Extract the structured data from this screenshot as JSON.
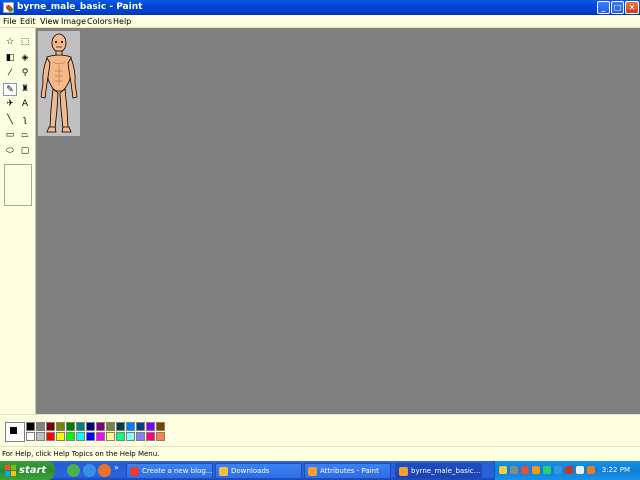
{
  "window": {
    "title": "byrne_male_basic - Paint",
    "buttons": {
      "minimize": "_",
      "maximize": "□",
      "close": "✕"
    }
  },
  "menubar": {
    "items": [
      {
        "label": "File"
      },
      {
        "label": "Edit"
      },
      {
        "label": "View"
      },
      {
        "label": "Image"
      },
      {
        "label": "Colors"
      },
      {
        "label": "Help"
      }
    ]
  },
  "toolbox": {
    "tools": [
      {
        "name": "free-form-select-icon",
        "glyph": "☆"
      },
      {
        "name": "rect-select-icon",
        "glyph": "⬚"
      },
      {
        "name": "eraser-icon",
        "glyph": "◧"
      },
      {
        "name": "fill-bucket-icon",
        "glyph": "◈"
      },
      {
        "name": "pick-color-icon",
        "glyph": "⁄"
      },
      {
        "name": "magnifier-icon",
        "glyph": "⚲"
      },
      {
        "name": "pencil-icon",
        "glyph": "✎",
        "selected": true
      },
      {
        "name": "brush-icon",
        "glyph": "♜"
      },
      {
        "name": "airbrush-icon",
        "glyph": "✈"
      },
      {
        "name": "text-icon",
        "glyph": "A"
      },
      {
        "name": "line-icon",
        "glyph": "╲"
      },
      {
        "name": "curve-icon",
        "glyph": "ʅ"
      },
      {
        "name": "rectangle-icon",
        "glyph": "▭"
      },
      {
        "name": "polygon-icon",
        "glyph": "⏢"
      },
      {
        "name": "ellipse-icon",
        "glyph": "⬭"
      },
      {
        "name": "rounded-rect-icon",
        "glyph": "▢"
      }
    ]
  },
  "palette": {
    "foreground": "#000000",
    "background": "#ffffff",
    "colors": [
      "#000000",
      "#808080",
      "#800000",
      "#808000",
      "#008000",
      "#008080",
      "#000080",
      "#800080",
      "#808040",
      "#004040",
      "#0080ff",
      "#004080",
      "#8000ff",
      "#804000",
      "#ffffff",
      "#c0c0c0",
      "#ff0000",
      "#ffff00",
      "#00ff00",
      "#00ffff",
      "#0000ff",
      "#ff00ff",
      "#ffff80",
      "#00ff80",
      "#80ffff",
      "#8080ff",
      "#ff0080",
      "#ff8040"
    ]
  },
  "status": {
    "text": "For Help, click Help Topics on the Help Menu."
  },
  "taskbar": {
    "start_label": "start",
    "quicklaunch_more": "»",
    "tasks": [
      {
        "label": "Create a new blog...",
        "icon_color": "#e04030",
        "active": false
      },
      {
        "label": "Downloads",
        "icon_color": "#f0c040",
        "active": false
      },
      {
        "label": "Attributes - Paint",
        "icon_color": "#f0a030",
        "active": false
      },
      {
        "label": "byrne_male_basic...",
        "icon_color": "#f0a030",
        "active": true
      }
    ],
    "clock": "3:22 PM"
  }
}
